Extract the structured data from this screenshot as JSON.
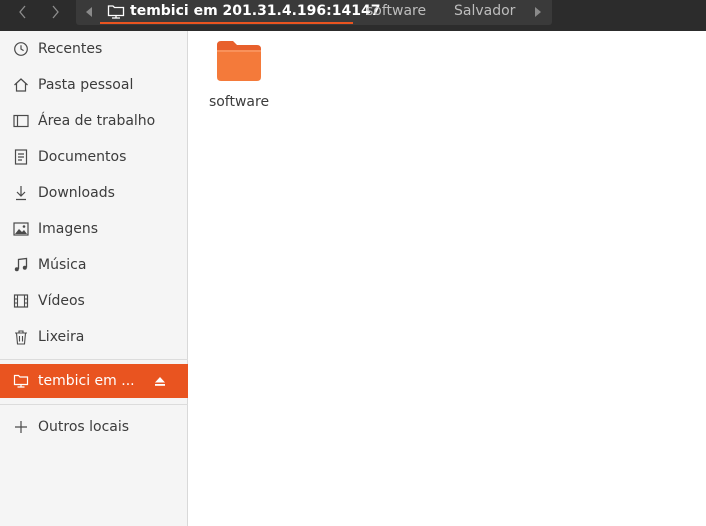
{
  "header": {
    "pathbar": {
      "current": "tembici em 201.31.4.196:14147",
      "crumbs": [
        "software",
        "Salvador"
      ]
    }
  },
  "sidebar": {
    "items": [
      {
        "label": "Recentes",
        "icon": "clock-icon"
      },
      {
        "label": "Pasta pessoal",
        "icon": "home-icon"
      },
      {
        "label": "Área de trabalho",
        "icon": "desktop-icon"
      },
      {
        "label": "Documentos",
        "icon": "document-icon"
      },
      {
        "label": "Downloads",
        "icon": "download-icon"
      },
      {
        "label": "Imagens",
        "icon": "image-icon"
      },
      {
        "label": "Música",
        "icon": "music-icon"
      },
      {
        "label": "Vídeos",
        "icon": "video-icon"
      },
      {
        "label": "Lixeira",
        "icon": "trash-icon"
      }
    ],
    "network_mount": {
      "label": "tembici em ...",
      "icon": "network-folder-icon"
    },
    "other_locations": {
      "label": "Outros locais",
      "icon": "plus-icon"
    }
  },
  "main": {
    "files": [
      {
        "name": "software",
        "icon": "folder-icon"
      }
    ]
  },
  "colors": {
    "accent": "#e95420",
    "folder": "#f47a3a",
    "header_bg": "#2c2c2c"
  }
}
